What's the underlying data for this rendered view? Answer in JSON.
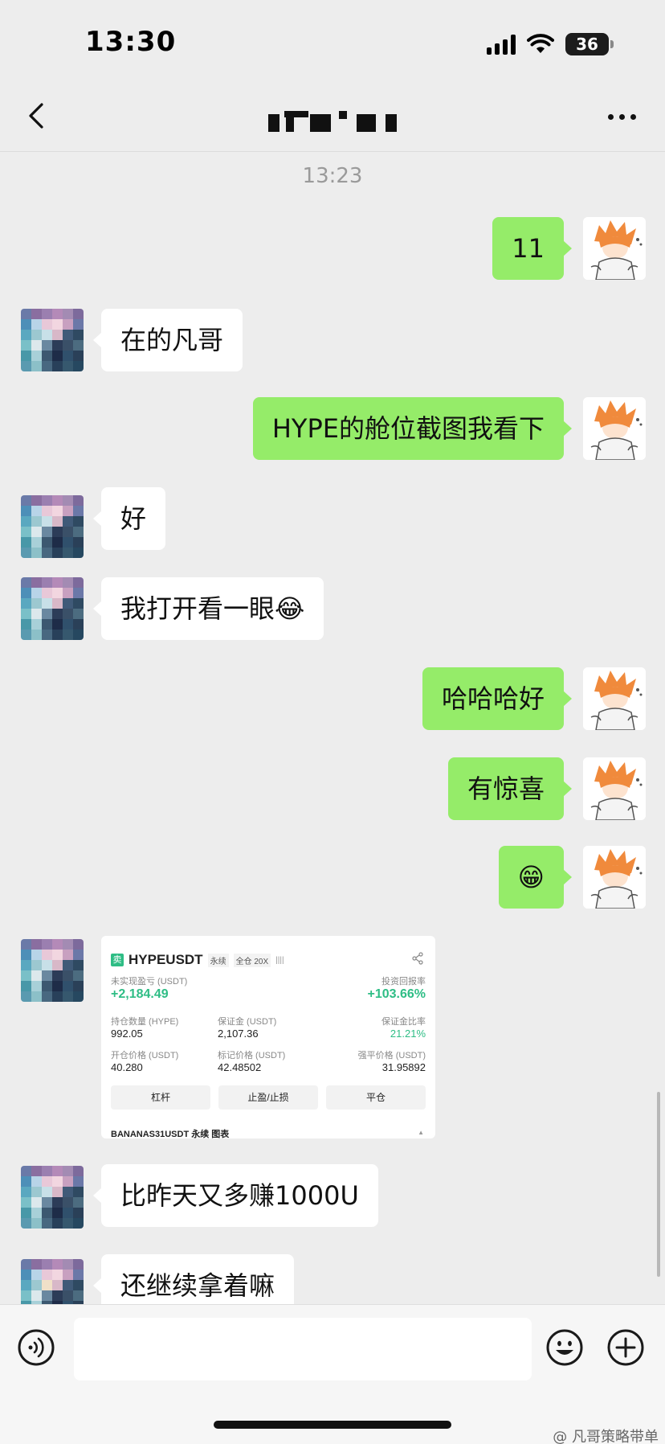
{
  "status": {
    "time": "13:30",
    "battery": "36"
  },
  "header": {
    "title": ""
  },
  "chat": {
    "timestamp": "13:23",
    "messages": [
      {
        "from": "me",
        "text": "11"
      },
      {
        "from": "them",
        "text": "在的凡哥"
      },
      {
        "from": "me",
        "text": "HYPE的舱位截图我看下"
      },
      {
        "from": "them",
        "text": "好"
      },
      {
        "from": "them",
        "text": "我打开看一眼😂"
      },
      {
        "from": "me",
        "text": "哈哈哈好"
      },
      {
        "from": "me",
        "text": "有惊喜"
      },
      {
        "from": "me",
        "text": "😁"
      },
      {
        "from": "them",
        "text": "比昨天又多赚1000U"
      },
      {
        "from": "them",
        "text": "还继续拿着嘛"
      }
    ]
  },
  "trade_card": {
    "side": "卖",
    "symbol": "HYPEUSDT",
    "type_tag": "永续",
    "margin_tag": "全仓 20X",
    "bars": "||||",
    "unrealized_pnl_label": "未实现盈亏 (USDT)",
    "unrealized_pnl": "+2,184.49",
    "roi_label": "投资回报率",
    "roi": "+103.66%",
    "position_label": "持仓数量 (HYPE)",
    "position": "992.05",
    "margin_label": "保证金 (USDT)",
    "margin": "2,107.36",
    "margin_ratio_label": "保证金比率",
    "margin_ratio": "21.21%",
    "entry_label": "开仓价格 (USDT)",
    "entry": "40.280",
    "mark_label": "标记价格 (USDT)",
    "mark": "42.48502",
    "liq_label": "强平价格 (USDT)",
    "liq": "31.95892",
    "btn_leverage": "杠杆",
    "btn_tpsl": "止盈/止损",
    "btn_close": "平仓",
    "footer": "BANANAS31USDT 永续 图表",
    "footer_arrow": "▲"
  },
  "input": {
    "placeholder": ""
  },
  "watermark": {
    "text": "@ 凡哥策略带单"
  },
  "colors": {
    "background": "#ededed",
    "incoming_bubble": "#ffffff",
    "outgoing_bubble": "#95ec69",
    "trade_green": "#2ebd85"
  }
}
